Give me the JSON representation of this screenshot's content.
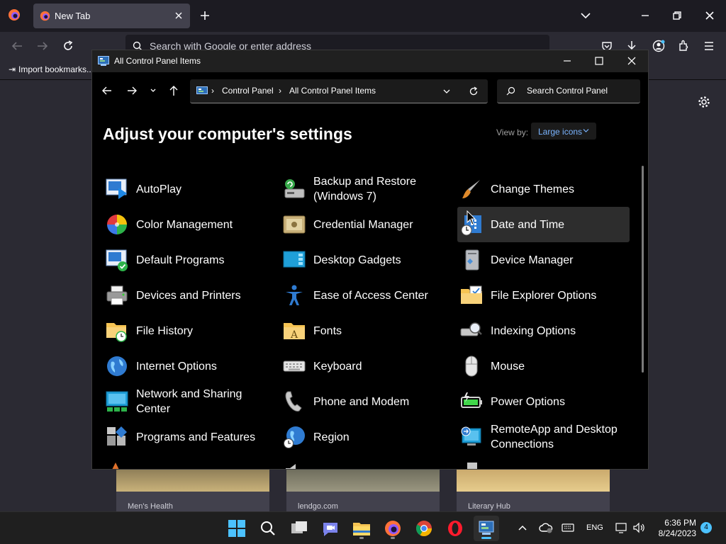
{
  "browser": {
    "tab_title": "New Tab",
    "url_placeholder": "Search with Google or enter address",
    "bookmarks_import": "Import bookmarks...",
    "tiles": [
      {
        "caption": "Men's Health"
      },
      {
        "caption": "lendgo.com"
      },
      {
        "caption": "Literary Hub"
      }
    ]
  },
  "window": {
    "title": "All Control Panel Items",
    "breadcrumb": [
      "Control Panel",
      "All Control Panel Items"
    ],
    "search_placeholder": "Search Control Panel",
    "heading": "Adjust your computer's settings",
    "view_by_label": "View by:",
    "view_by_value": "Large icons"
  },
  "items": [
    {
      "label": "AutoPlay",
      "icon": "autoplay-icon"
    },
    {
      "label": "Backup and Restore (Windows 7)",
      "icon": "backup-restore-icon"
    },
    {
      "label": "Change Themes",
      "icon": "paintbrush-icon"
    },
    {
      "label": "Color Management",
      "icon": "color-wheel-icon"
    },
    {
      "label": "Credential Manager",
      "icon": "credential-vault-icon"
    },
    {
      "label": "Date and Time",
      "icon": "calendar-clock-icon"
    },
    {
      "label": "Default Programs",
      "icon": "default-programs-icon"
    },
    {
      "label": "Desktop Gadgets",
      "icon": "gadgets-icon"
    },
    {
      "label": "Device Manager",
      "icon": "device-manager-icon"
    },
    {
      "label": "Devices and Printers",
      "icon": "printer-icon"
    },
    {
      "label": "Ease of Access Center",
      "icon": "accessibility-icon"
    },
    {
      "label": "File Explorer Options",
      "icon": "folder-options-icon"
    },
    {
      "label": "File History",
      "icon": "file-history-icon"
    },
    {
      "label": "Fonts",
      "icon": "fonts-folder-icon"
    },
    {
      "label": "Indexing Options",
      "icon": "indexing-icon"
    },
    {
      "label": "Internet Options",
      "icon": "globe-icon"
    },
    {
      "label": "Keyboard",
      "icon": "keyboard-icon"
    },
    {
      "label": "Mouse",
      "icon": "mouse-icon"
    },
    {
      "label": "Network and Sharing Center",
      "icon": "network-icon"
    },
    {
      "label": "Phone and Modem",
      "icon": "phone-icon"
    },
    {
      "label": "Power Options",
      "icon": "battery-icon"
    },
    {
      "label": "Programs and Features",
      "icon": "programs-icon"
    },
    {
      "label": "Region",
      "icon": "region-globe-icon"
    },
    {
      "label": "RemoteApp and Desktop Connections",
      "icon": "remote-desktop-icon"
    }
  ],
  "taskbar": {
    "language": "ENG",
    "time": "6:36 PM",
    "date": "8/24/2023",
    "notification_count": "4"
  }
}
